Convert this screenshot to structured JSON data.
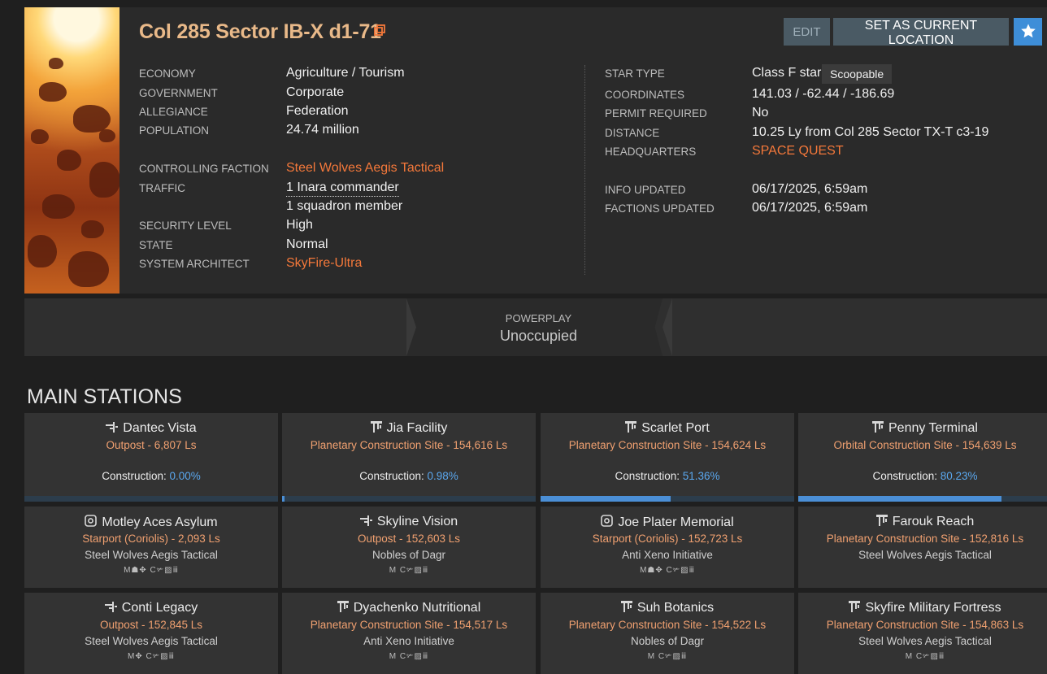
{
  "system": {
    "title": "Col 285 Sector IB-X d1-71",
    "buttons": {
      "edit": "EDIT",
      "set_location": "SET AS CURRENT LOCATION"
    },
    "left": {
      "economy_label": "ECONOMY",
      "economy": "Agriculture / Tourism",
      "government_label": "GOVERNMENT",
      "government": "Corporate",
      "allegiance_label": "ALLEGIANCE",
      "allegiance": "Federation",
      "population_label": "POPULATION",
      "population": "24.74 million",
      "controlling_faction_label": "CONTROLLING FACTION",
      "controlling_faction": "Steel Wolves Aegis Tactical",
      "traffic_label": "TRAFFIC",
      "traffic_commanders": "1 Inara commander",
      "traffic_squadron": "1 squadron member",
      "security_label": "SECURITY LEVEL",
      "security": "High",
      "state_label": "STATE",
      "state": "Normal",
      "architect_label": "SYSTEM ARCHITECT",
      "architect": "SkyFire-Ultra"
    },
    "right": {
      "star_type_label": "STAR TYPE",
      "star_type": "Class F star",
      "scoopable": "Scoopable",
      "coordinates_label": "COORDINATES",
      "coordinates": "141.03 / -62.44 / -186.69",
      "permit_label": "PERMIT REQUIRED",
      "permit": "No",
      "distance_label": "DISTANCE",
      "distance": "10.25 Ly from Col 285 Sector TX-T c3-19",
      "hq_label": "HEADQUARTERS",
      "hq": "SPACE QUEST",
      "info_updated_label": "INFO UPDATED",
      "info_updated": "06/17/2025, 6:59am",
      "factions_updated_label": "FACTIONS UPDATED",
      "factions_updated": "06/17/2025, 6:59am"
    }
  },
  "powerplay": {
    "label": "POWERPLAY",
    "value": "Unoccupied"
  },
  "main_stations": {
    "title": "MAIN STATIONS",
    "construction_label": "Construction: ",
    "items": [
      {
        "name": "Dantec Vista",
        "icon": "outpost-icon",
        "subtitle": "Outpost - 6,807 Ls",
        "construction": "0.00%",
        "progress": 0.0
      },
      {
        "name": "Jia Facility",
        "icon": "planetary-construction-icon",
        "subtitle": "Planetary Construction Site - 154,616 Ls",
        "construction": "0.98%",
        "progress": 0.0098
      },
      {
        "name": "Scarlet Port",
        "icon": "planetary-construction-icon",
        "subtitle": "Planetary Construction Site - 154,624 Ls",
        "construction": "51.36%",
        "progress": 0.5136
      },
      {
        "name": "Penny Terminal",
        "icon": "orbital-construction-icon",
        "subtitle": "Orbital Construction Site - 154,639 Ls",
        "construction": "80.23%",
        "progress": 0.8023
      },
      {
        "name": "Motley Aces Asylum",
        "icon": "starport-coriolis-icon",
        "subtitle": "Starport (Coriolis) - 2,093 Ls",
        "faction": "Steel Wolves Aegis Tactical",
        "services": "M☗✥ C✃▨ⅲ"
      },
      {
        "name": "Skyline Vision",
        "icon": "outpost-icon",
        "subtitle": "Outpost - 152,603 Ls",
        "faction": "Nobles of Dagr",
        "services": "M C✃▨ⅲ"
      },
      {
        "name": "Joe Plater Memorial",
        "icon": "starport-coriolis-icon",
        "subtitle": "Starport (Coriolis) - 152,723 Ls",
        "faction": "Anti Xeno Initiative",
        "services": "M☗✥ C✃▨ⅲ"
      },
      {
        "name": "Farouk Reach",
        "icon": "planetary-construction-icon",
        "subtitle": "Planetary Construction Site - 152,816 Ls",
        "faction": "Steel Wolves Aegis Tactical"
      },
      {
        "name": "Conti Legacy",
        "icon": "outpost-icon",
        "subtitle": "Outpost - 152,845 Ls",
        "faction": "Steel Wolves Aegis Tactical",
        "services": "M✥ C✃▨ⅲ"
      },
      {
        "name": "Dyachenko Nutritional",
        "icon": "planetary-construction-icon",
        "subtitle": "Planetary Construction Site - 154,517 Ls",
        "faction": "Anti Xeno Initiative",
        "services": "M C✃▨ⅲ"
      },
      {
        "name": "Suh Botanics",
        "icon": "planetary-construction-icon",
        "subtitle": "Planetary Construction Site - 154,522 Ls",
        "faction": "Nobles of Dagr",
        "services": "M C✃▨ⅲ"
      },
      {
        "name": "Skyfire Military Fortress",
        "icon": "planetary-construction-icon",
        "subtitle": "Planetary Construction Site - 154,863 Ls",
        "faction": "Steel Wolves Aegis Tactical",
        "services": "M C✃▨ⅲ"
      }
    ]
  },
  "colors": {
    "accent_orange": "#f4783a",
    "title_tan": "#e9b989",
    "progress_blue": "#4b8fd6",
    "fav_blue": "#3e8ed8"
  }
}
